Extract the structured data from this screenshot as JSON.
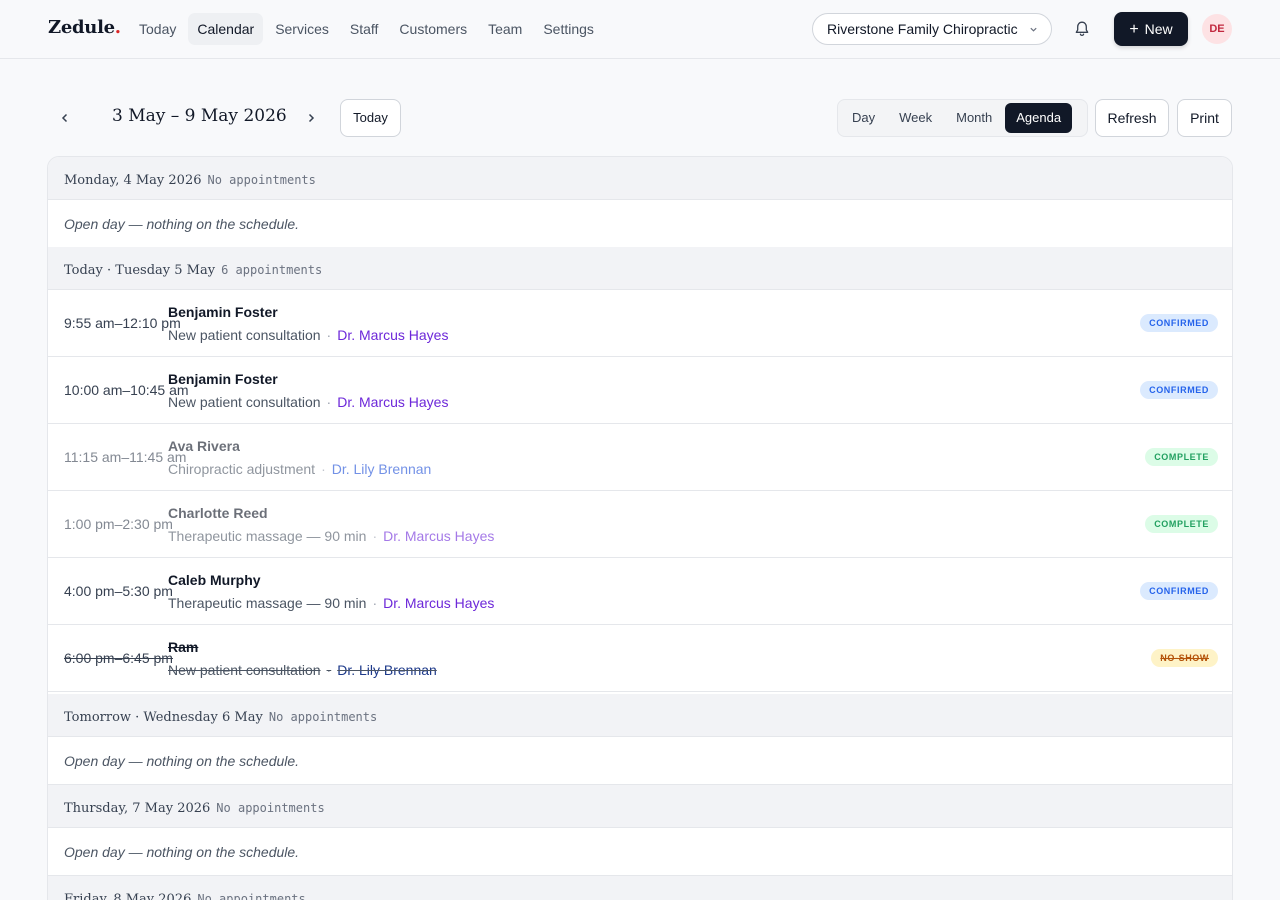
{
  "header": {
    "logo": "Zedule",
    "logo_dot": ".",
    "nav": [
      "Today",
      "Calendar",
      "Services",
      "Staff",
      "Customers",
      "Team",
      "Settings"
    ],
    "nav_active": "Calendar",
    "business": "Riverstone Family Chiropractic",
    "new_label": "New",
    "new_plus": "+",
    "avatar": "DE"
  },
  "toolbar": {
    "prev": "‹",
    "next": "›",
    "range": "3 May – 9 May 2026",
    "today": "Today",
    "views": [
      "Day",
      "Week",
      "Month",
      "Agenda"
    ],
    "view_active": "Agenda",
    "refresh": "Refresh",
    "print": "Print"
  },
  "days": [
    {
      "name": "Monday, 4 May 2026",
      "count": "No appointments",
      "empty_text": "Open day — nothing on the schedule."
    },
    {
      "name": "Today · Tuesday 5 May",
      "count": "6 appointments"
    },
    {
      "name": "Tomorrow · Wednesday 6 May",
      "count": "No appointments",
      "empty_text": "Open day — nothing on the schedule."
    },
    {
      "name": "Thursday, 7 May 2026",
      "count": "No appointments",
      "empty_text": "Open day — nothing on the schedule."
    },
    {
      "name": "Friday, 8 May 2026",
      "count": "No appointments"
    }
  ],
  "appointments": [
    {
      "time": "9:55 am–12:10 pm",
      "customer": "Benjamin Foster",
      "service": "New patient consultation",
      "sep": "·",
      "staff": "Dr. Marcus Hayes",
      "status": "CONFIRMED"
    },
    {
      "time": "10:00 am–10:45 am",
      "customer": "Benjamin Foster",
      "service": "New patient consultation",
      "sep": "·",
      "staff": "Dr. Marcus Hayes",
      "status": "CONFIRMED"
    },
    {
      "time": "11:15 am–11:45 am",
      "customer": "Ava Rivera",
      "service": "Chiropractic adjustment",
      "sep": "·",
      "staff": "Dr. Lily Brennan",
      "status": "COMPLETE"
    },
    {
      "time": "1:00 pm–2:30 pm",
      "customer": "Charlotte Reed",
      "service": "Therapeutic massage — 90 min",
      "sep": "·",
      "staff": "Dr. Marcus Hayes",
      "status": "COMPLETE"
    },
    {
      "time": "4:00 pm–5:30 pm",
      "customer": "Caleb Murphy",
      "service": "Therapeutic massage — 90 min",
      "sep": "·",
      "staff": "Dr. Marcus Hayes",
      "status": "CONFIRMED"
    },
    {
      "time": "6:00 pm–6:45 pm",
      "customer": "Ram",
      "service": "New patient consultation",
      "sep": "·",
      "staff": "Dr. Lily Brennan",
      "status": "NO-SHOW"
    }
  ],
  "colors": {
    "primary": "#111827",
    "accent_red": "#dc2626",
    "staff_purple": "#6d28d9",
    "staff_blue": "#1d4ed8",
    "confirmed": "#2563eb",
    "complete": "#22a060",
    "noshow": "#b45309"
  }
}
